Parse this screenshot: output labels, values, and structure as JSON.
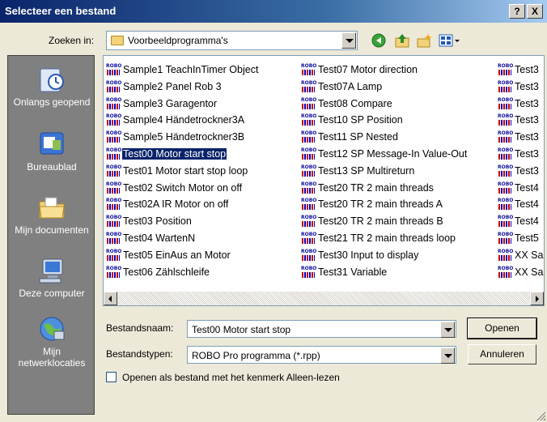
{
  "window": {
    "title": "Selecteer een bestand",
    "help_label": "?",
    "close_label": "X"
  },
  "lookin": {
    "label": "Zoeken in:",
    "value": "Voorbeeldprogramma's"
  },
  "toolbar": {
    "icons": [
      "back-icon",
      "up-folder-icon",
      "new-folder-icon",
      "views-menu-icon"
    ]
  },
  "places": [
    {
      "label": "Onlangs geopend",
      "icon": "recent-icon"
    },
    {
      "label": "Bureaublad",
      "icon": "desktop-icon"
    },
    {
      "label": "Mijn documenten",
      "icon": "my-documents-icon"
    },
    {
      "label": "Deze computer",
      "icon": "computer-icon"
    },
    {
      "label": "Mijn netwerklocaties",
      "icon": "network-icon"
    }
  ],
  "files": {
    "col1": [
      "Sample1 TeachInTimer Object",
      "Sample2 Panel Rob 3",
      "Sample3 Garagentor",
      "Sample4 Händetrockner3A",
      "Sample5 Händetrockner3B",
      "Test00 Motor start stop",
      "Test01 Motor start stop loop",
      "Test02 Switch Motor on off",
      "Test02A IR Motor on off",
      "Test03 Position",
      "Test04 WartenN",
      "Test05 EinAus an Motor",
      "Test06 Zählschleife"
    ],
    "col2": [
      "Test07 Motor direction",
      "Test07A Lamp",
      "Test08 Compare",
      "Test10 SP Position",
      "Test11 SP Nested",
      "Test12 SP Message-In Value-Out",
      "Test13 SP Multireturn",
      "Test20 TR 2 main threads",
      "Test20 TR 2 main threads A",
      "Test20 TR 2 main threads B",
      "Test21 TR 2 main threads loop",
      "Test30 Input to display",
      "Test31 Variable"
    ],
    "col3": [
      "Test3",
      "Test3",
      "Test3",
      "Test3",
      "Test3",
      "Test3",
      "Test3",
      "Test4",
      "Test4",
      "Test4",
      "Test5",
      "XX Sa",
      "XX Sa"
    ],
    "selected": "Test00 Motor start stop",
    "icon_badge": "ROBO"
  },
  "filename": {
    "label": "Bestandsnaam:",
    "value": "Test00 Motor start stop"
  },
  "filetype": {
    "label": "Bestandstypen:",
    "value": "ROBO Pro programma (*.rpp)"
  },
  "buttons": {
    "open": "Openen",
    "cancel": "Annuleren"
  },
  "readonly_checkbox": {
    "label": "Openen als bestand met het kenmerk Alleen-lezen",
    "checked": false
  },
  "colors": {
    "selection": "#0a246a",
    "places_bg": "#808080",
    "dialog_bg": "#ece9d8"
  }
}
